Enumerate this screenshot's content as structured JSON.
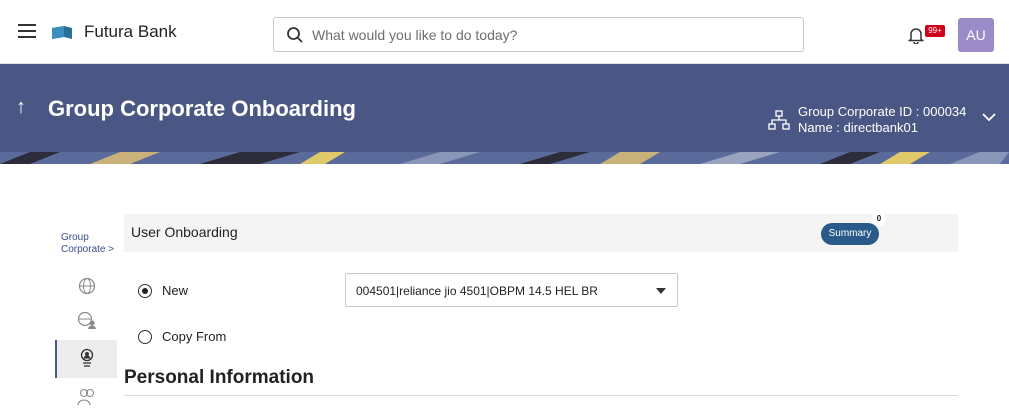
{
  "header": {
    "brand": "Futura Bank",
    "search_placeholder": "What would you like to do today?",
    "notification_badge": "99+",
    "avatar_initials": "AU"
  },
  "banner": {
    "title": "Group Corporate Onboarding",
    "group_corporate_id": "Group Corporate ID : 000034",
    "name": "Name : directbank01"
  },
  "nav": {
    "breadcrumb_line1": "Group",
    "breadcrumb_line2": "Corporate >",
    "icons": [
      "globe-icon",
      "globe-user-icon",
      "user-onboarding-icon",
      "users-group-icon"
    ]
  },
  "main": {
    "section_title": "User Onboarding",
    "summary_label": "Summary",
    "summary_count": "0",
    "options": [
      {
        "label": "New",
        "selected": true
      },
      {
        "label": "Copy From",
        "selected": false
      }
    ],
    "party_select_value": "004501|reliance jio 4501|OBPM 14.5 HEL BR",
    "personal_info_heading": "Personal Information"
  },
  "colors": {
    "banner": "#4a5785",
    "summary_button": "#2a5a8a",
    "badge": "#d0021b",
    "avatar": "#9b8bc9"
  }
}
